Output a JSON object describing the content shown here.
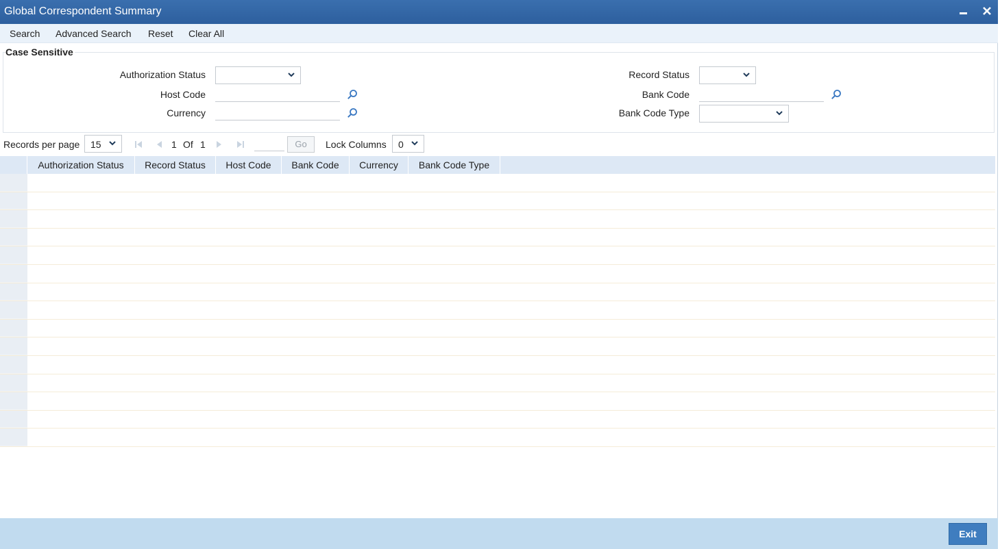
{
  "window": {
    "title": "Global Correspondent Summary",
    "minimize_icon": "minimize-icon",
    "close_icon": "close-icon"
  },
  "toolbar": {
    "search": "Search",
    "advanced_search": "Advanced Search",
    "reset": "Reset",
    "clear_all": "Clear All"
  },
  "criteria": {
    "legend": "Case Sensitive",
    "authorization_status": {
      "label": "Authorization Status",
      "value": ""
    },
    "host_code": {
      "label": "Host Code",
      "value": ""
    },
    "currency": {
      "label": "Currency",
      "value": ""
    },
    "record_status": {
      "label": "Record Status",
      "value": ""
    },
    "bank_code": {
      "label": "Bank Code",
      "value": ""
    },
    "bank_code_type": {
      "label": "Bank Code Type",
      "value": ""
    }
  },
  "pager": {
    "records_per_page_label": "Records per page",
    "records_per_page": "15",
    "current_page": "1",
    "of_label": "Of",
    "total_pages": "1",
    "go_label": "Go",
    "lock_columns_label": "Lock Columns",
    "lock_columns": "0"
  },
  "grid": {
    "columns": [
      "Authorization Status",
      "Record Status",
      "Host Code",
      "Bank Code",
      "Currency",
      "Bank Code Type"
    ],
    "row_count": 15
  },
  "footer": {
    "exit_label": "Exit"
  },
  "colors": {
    "title_bar": "#2d5f9e",
    "toolbar": "#eaf2fa",
    "grid_header": "#dde8f5",
    "footer": "#c1dbef",
    "exit_button": "#3f7dbf"
  }
}
